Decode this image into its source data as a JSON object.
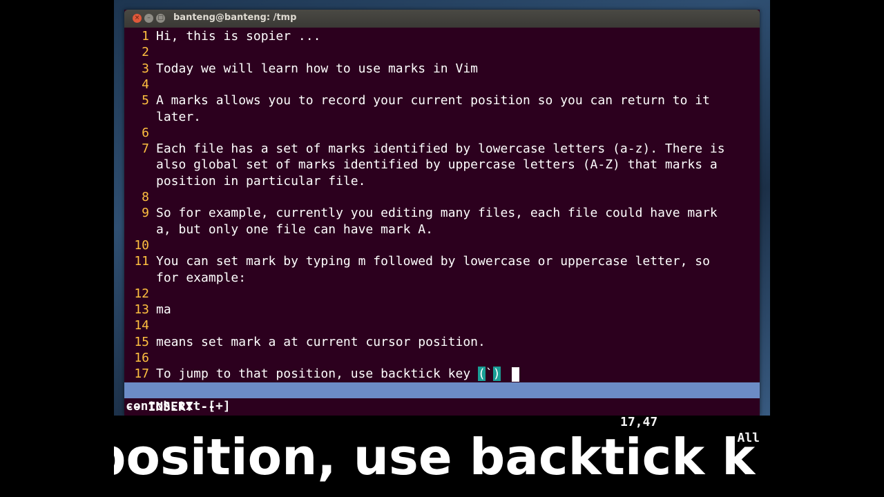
{
  "window": {
    "title": "banteng@banteng: /tmp",
    "buttons": {
      "close": "×",
      "minimize": "–",
      "maximize": "□"
    }
  },
  "editor": {
    "lines": [
      {
        "num": "1",
        "text": "Hi, this is sopier ..."
      },
      {
        "num": "2",
        "text": ""
      },
      {
        "num": "3",
        "text": "Today we will learn how to use marks in Vim"
      },
      {
        "num": "4",
        "text": ""
      },
      {
        "num": "5",
        "text": "A marks allows you to record your current position so you can return to it"
      },
      {
        "num": "",
        "text": "later."
      },
      {
        "num": "6",
        "text": ""
      },
      {
        "num": "7",
        "text": "Each file has a set of marks identified by lowercase letters (a-z). There is"
      },
      {
        "num": "",
        "text": "also global set of marks identified by uppercase letters (A-Z) that marks a"
      },
      {
        "num": "",
        "text": "position in particular file."
      },
      {
        "num": "8",
        "text": ""
      },
      {
        "num": "9",
        "text": "So for example, currently you editing many files, each file could have mark"
      },
      {
        "num": "",
        "text": "a, but only one file can have mark A."
      },
      {
        "num": "10",
        "text": ""
      },
      {
        "num": "11",
        "text": "You can set mark by typing m followed by lowercase or uppercase letter, so"
      },
      {
        "num": "",
        "text": "for example:"
      },
      {
        "num": "12",
        "text": ""
      },
      {
        "num": "13",
        "text": "ma"
      },
      {
        "num": "14",
        "text": ""
      },
      {
        "num": "15",
        "text": "means set mark a at current cursor position."
      },
      {
        "num": "16",
        "text": ""
      }
    ],
    "cursor_line": {
      "num": "17",
      "text_before": "To jump to that position, use backtick key ",
      "open_paren": "(",
      "backtick": "`",
      "close_paren": ")"
    }
  },
  "statusline": {
    "filename": "contoh.txt [+]",
    "position": "17,47",
    "scroll": "All"
  },
  "mode": "-- INSERT --",
  "caption": "position, use backtick k",
  "colors": {
    "terminal_bg": "#2c001e",
    "line_number": "#ffc040",
    "statusline_bg": "#6c8cc6",
    "paren_highlight": "#1a9e96"
  }
}
